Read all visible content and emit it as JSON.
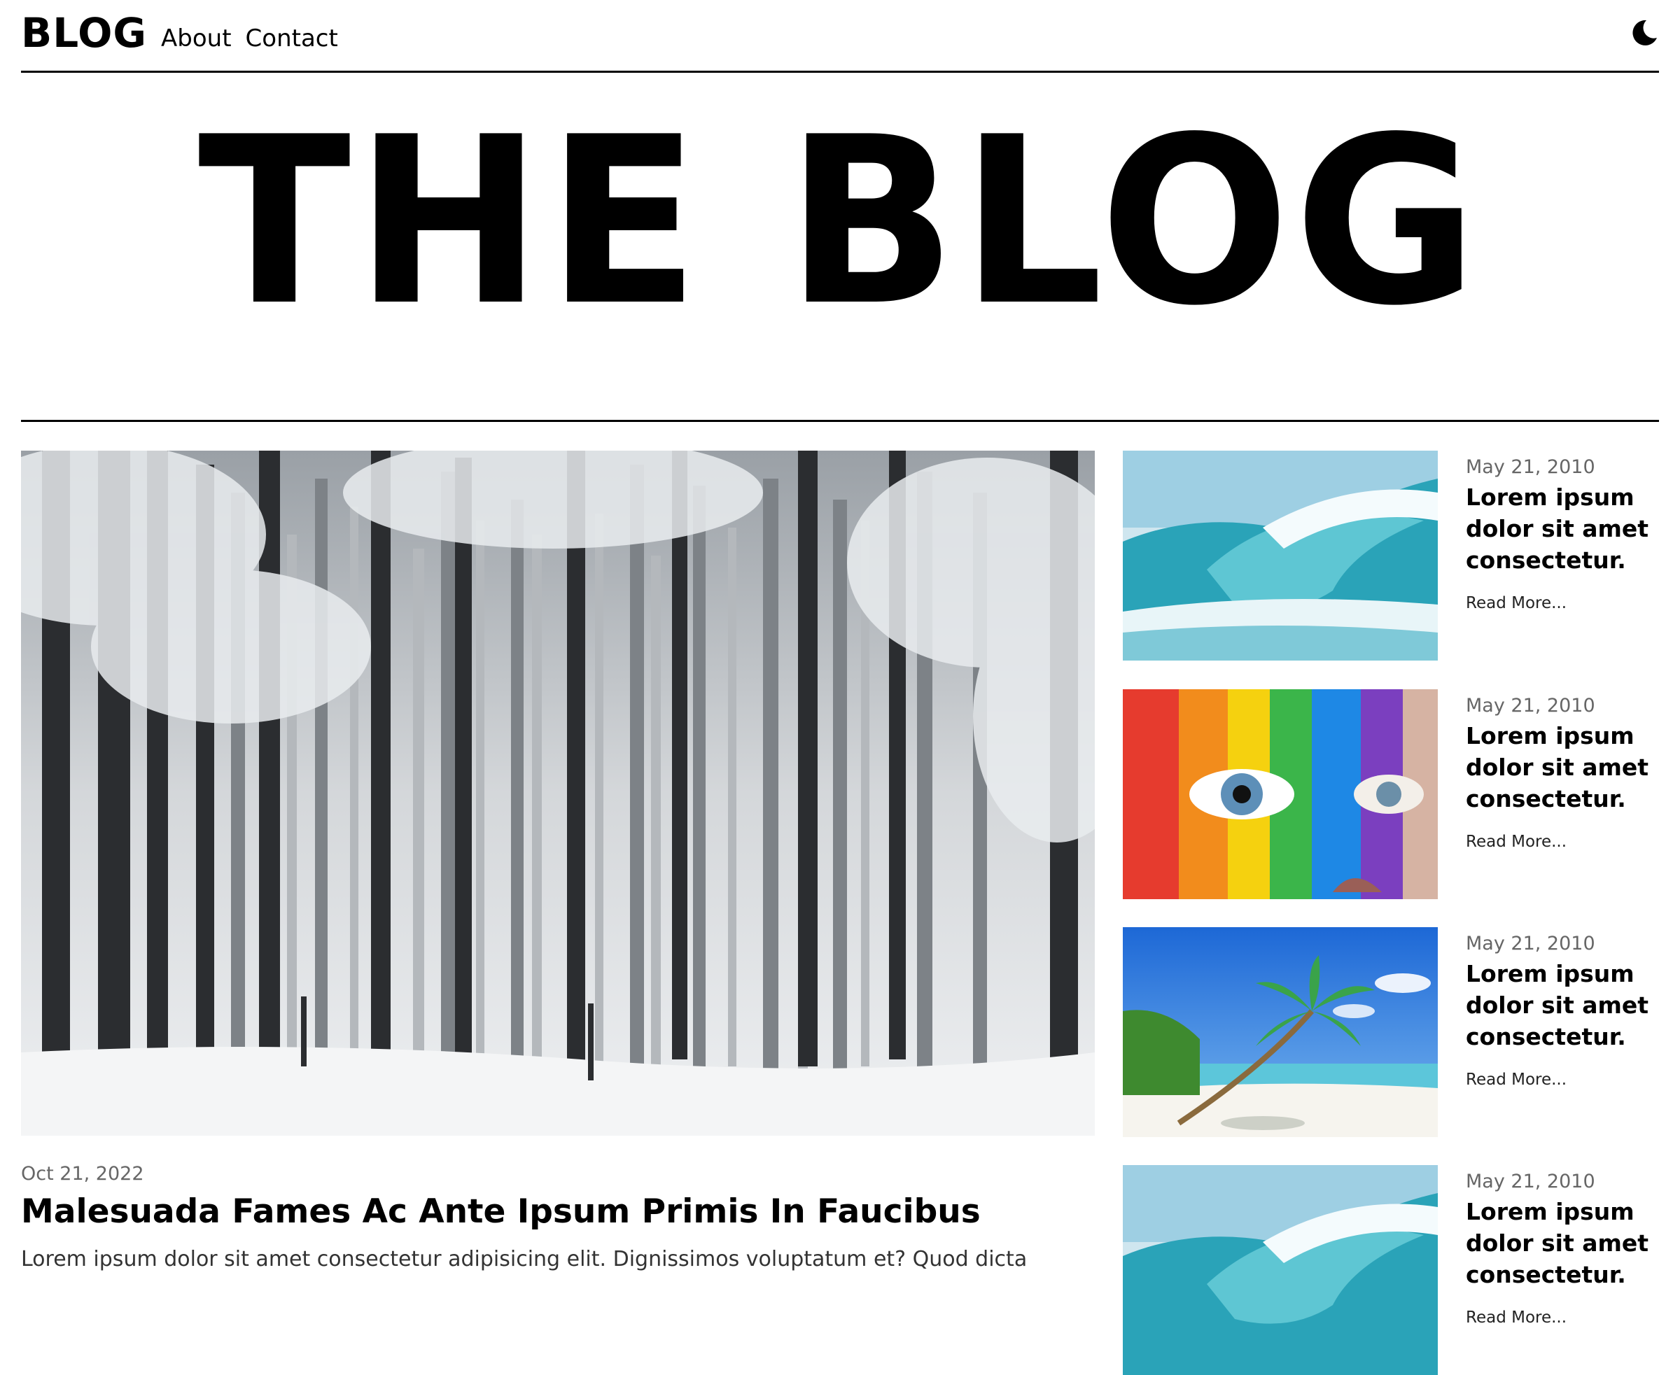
{
  "header": {
    "logo": "BLOG",
    "nav": [
      {
        "label": "About"
      },
      {
        "label": "Contact"
      }
    ],
    "theme_toggle_icon": "moon-icon"
  },
  "hero": {
    "title": "THE BLOG"
  },
  "featured": {
    "date": "Oct 21, 2022",
    "title": "Malesuada Fames Ac Ante Ipsum Primis In Faucibus",
    "excerpt": "Lorem ipsum dolor sit amet consectetur adipisicing elit. Dignissimos voluptatum et? Quod dicta"
  },
  "posts": [
    {
      "date": "May 21, 2010",
      "title": "Lorem ipsum dolor sit amet consectetur.",
      "read_more": "Read More..."
    },
    {
      "date": "May 21, 2010",
      "title": "Lorem ipsum dolor sit amet consectetur.",
      "read_more": "Read More..."
    },
    {
      "date": "May 21, 2010",
      "title": "Lorem ipsum dolor sit amet consectetur.",
      "read_more": "Read More..."
    },
    {
      "date": "May 21, 2010",
      "title": "Lorem ipsum dolor sit amet consectetur.",
      "read_more": "Read More..."
    }
  ]
}
